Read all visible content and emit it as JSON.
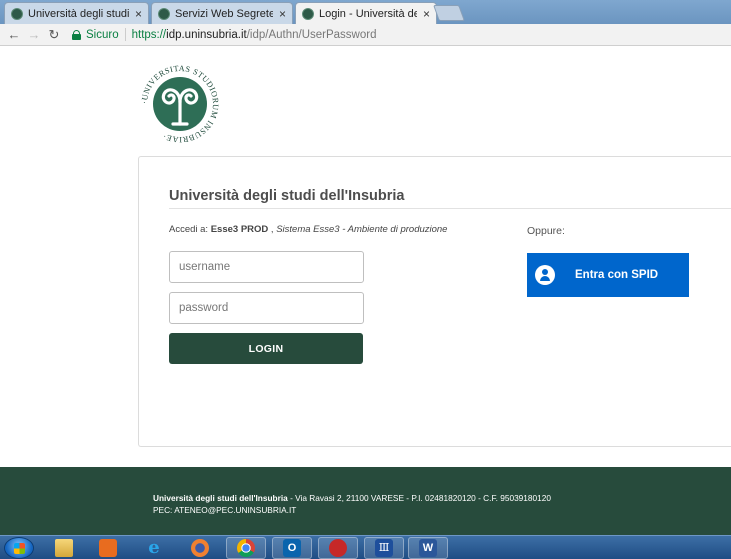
{
  "browser": {
    "tabs": [
      {
        "label": "Università degli studi dell'Insubria",
        "active": false
      },
      {
        "label": "Servizi Web Segreterie Studenti",
        "active": false
      },
      {
        "label": "Login - Università degli studi dell'Insubria",
        "active": true
      }
    ],
    "tab_close_glyph": "×",
    "nav": {
      "back_glyph": "←",
      "forward_glyph": "→",
      "reload_glyph": "↻"
    },
    "address": {
      "secure_label": "Sicuro",
      "scheme": "https://",
      "host": "idp.uninsubria.it",
      "path": "/idp/Authn/UserPassword"
    }
  },
  "page": {
    "logo": {
      "ring_text_top": "UNIVERSITAS STUDIORUM INSUBRIAE",
      "ring_text_bottom": "·UNIVERSITAS STUDIORUM INSUBRIAE·",
      "colors": {
        "disc": "#2e6e56",
        "ring": "#1f4a3b"
      }
    },
    "card": {
      "title": "Università degli studi dell'Insubria",
      "access_prefix": "Accedi a:",
      "service_name": "Esse3 PROD",
      "service_sep": ",",
      "service_desc": "Sistema Esse3 - Ambiente di produzione",
      "username_placeholder": "username",
      "password_placeholder": "password",
      "login_label": "LOGIN",
      "oppure_label": "Oppure:",
      "spid_label": "Entra con SPID"
    },
    "footer": {
      "org_name": "Università degli studi dell'Insubria",
      "address": " - Via Ravasi 2, 21100 VARESE - P.I. 02481820120 - C.F. 95039180120",
      "pec": "PEC: ATENEO@PEC.UNINSUBRIA.IT"
    }
  },
  "taskbar": {
    "items": [
      "windows-explorer",
      "media-player",
      "internet-explorer",
      "firefox",
      "chrome",
      "outlook",
      "red-app",
      "bank-app",
      "word"
    ],
    "outlook_glyph": "O",
    "bank_glyph": "Ⅲ",
    "word_glyph": "W",
    "ie_glyph": "e"
  },
  "colors": {
    "brand_green": "#274b3c",
    "spid_blue": "#0066cc",
    "secure_green": "#0b8043"
  }
}
